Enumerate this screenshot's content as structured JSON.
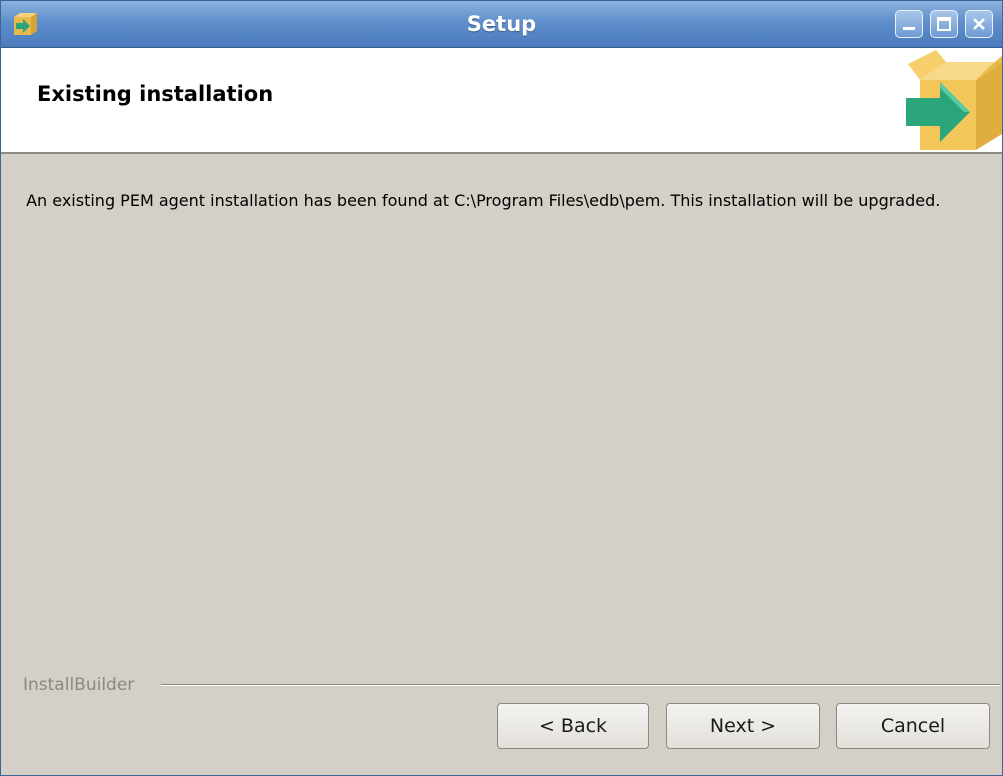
{
  "window": {
    "title": "Setup",
    "icon": "setup-box-icon"
  },
  "header": {
    "title": "Existing installation",
    "logo_icon": "box-arrow-icon"
  },
  "body": {
    "message": " An existing PEM agent installation has been found at C:\\Program Files\\edb\\pem. This installation will be upgraded."
  },
  "footer": {
    "brand": "InstallBuilder",
    "back_label": "< Back",
    "next_label": "Next >",
    "cancel_label": "Cancel"
  },
  "colors": {
    "titlebar": "#5f8fcb",
    "window_bg": "#d4d0c8",
    "box_orange": "#f3c65a",
    "arrow_green": "#2aa67a"
  }
}
